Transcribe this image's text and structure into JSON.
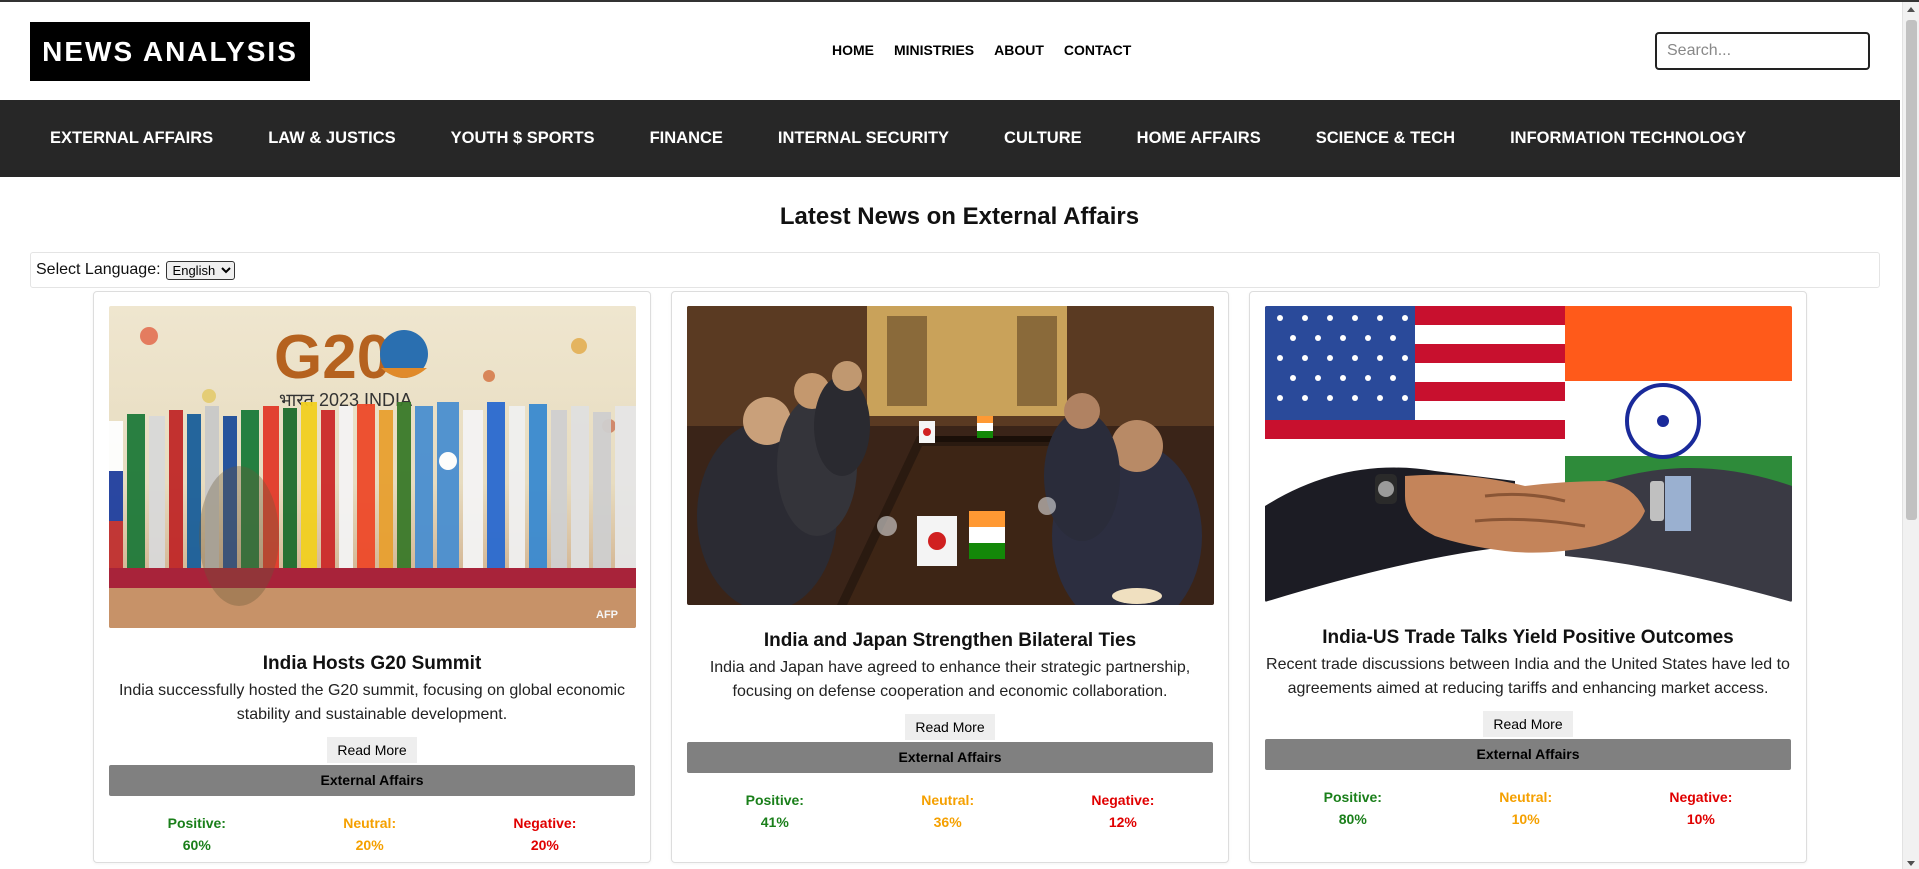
{
  "header": {
    "logo": "NEWS ANALYSIS",
    "nav": [
      "HOME",
      "MINISTRIES",
      "ABOUT",
      "CONTACT"
    ],
    "search_placeholder": "Search..."
  },
  "categories": [
    "EXTERNAL AFFAIRS",
    "LAW & JUSTICS",
    "YOUTH $ SPORTS",
    "FINANCE",
    "INTERNAL SECURITY",
    "CULTURE",
    "HOME AFFAIRS",
    "SCIENCE & TECH",
    "INFORMATION TECHNOLOGY"
  ],
  "main": {
    "heading": "Latest News on External Affairs",
    "language_label": "Select Language:",
    "language_selected": "English"
  },
  "cards": [
    {
      "title": "India Hosts G20 Summit",
      "description": "India successfully hosted the G20 summit, focusing on global economic stability and sustainable development.",
      "read_more": "Read More",
      "category": "External Affairs",
      "image_label": "AFP",
      "image_text": "G20",
      "image_subtext": "भारत 2023 INDIA",
      "positive_label": "Positive:",
      "positive": "60%",
      "neutral_label": "Neutral:",
      "neutral": "20%",
      "negative_label": "Negative:",
      "negative": "20%"
    },
    {
      "title": "India and Japan Strengthen Bilateral Ties",
      "description": "India and Japan have agreed to enhance their strategic partnership, focusing on defense cooperation and economic collaboration.",
      "read_more": "Read More",
      "category": "External Affairs",
      "positive_label": "Positive:",
      "positive": "41%",
      "neutral_label": "Neutral:",
      "neutral": "36%",
      "negative_label": "Negative:",
      "negative": "12%"
    },
    {
      "title": "India-US Trade Talks Yield Positive Outcomes",
      "description": "Recent trade discussions between India and the United States have led to agreements aimed at reducing tariffs and enhancing market access.",
      "read_more": "Read More",
      "category": "External Affairs",
      "positive_label": "Positive:",
      "positive": "80%",
      "neutral_label": "Neutral:",
      "neutral": "10%",
      "negative_label": "Negative:",
      "negative": "10%"
    }
  ]
}
